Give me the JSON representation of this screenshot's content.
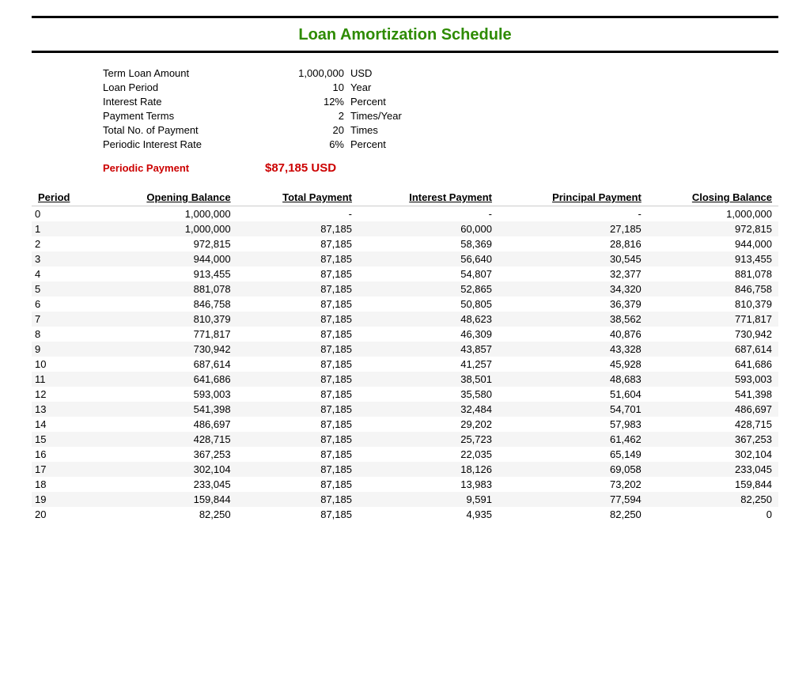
{
  "title": "Loan Amortization Schedule",
  "summary": {
    "rows": [
      {
        "label": "Term Loan Amount",
        "value": "1,000,000",
        "unit": "USD"
      },
      {
        "label": "Loan Period",
        "value": "10",
        "unit": "Year"
      },
      {
        "label": "Interest Rate",
        "value": "12%",
        "unit": "Percent"
      },
      {
        "label": "Payment Terms",
        "value": "2",
        "unit": "Times/Year"
      },
      {
        "label": "Total No. of Payment",
        "value": "20",
        "unit": "Times"
      },
      {
        "label": "Periodic Interest Rate",
        "value": "6%",
        "unit": "Percent"
      }
    ],
    "periodic_payment_label": "Periodic Payment",
    "periodic_payment_value": "$87,185",
    "periodic_payment_unit": "USD"
  },
  "table": {
    "headers": [
      "Period",
      "Opening Balance",
      "Total Payment",
      "Interest Payment",
      "Principal Payment",
      "Closing Balance"
    ],
    "rows": [
      {
        "period": "0",
        "opening": "1,000,000",
        "total": "-",
        "interest": "-",
        "principal": "-",
        "closing": "1,000,000"
      },
      {
        "period": "1",
        "opening": "1,000,000",
        "total": "87,185",
        "interest": "60,000",
        "principal": "27,185",
        "closing": "972,815"
      },
      {
        "period": "2",
        "opening": "972,815",
        "total": "87,185",
        "interest": "58,369",
        "principal": "28,816",
        "closing": "944,000"
      },
      {
        "period": "3",
        "opening": "944,000",
        "total": "87,185",
        "interest": "56,640",
        "principal": "30,545",
        "closing": "913,455"
      },
      {
        "period": "4",
        "opening": "913,455",
        "total": "87,185",
        "interest": "54,807",
        "principal": "32,377",
        "closing": "881,078"
      },
      {
        "period": "5",
        "opening": "881,078",
        "total": "87,185",
        "interest": "52,865",
        "principal": "34,320",
        "closing": "846,758"
      },
      {
        "period": "6",
        "opening": "846,758",
        "total": "87,185",
        "interest": "50,805",
        "principal": "36,379",
        "closing": "810,379"
      },
      {
        "period": "7",
        "opening": "810,379",
        "total": "87,185",
        "interest": "48,623",
        "principal": "38,562",
        "closing": "771,817"
      },
      {
        "period": "8",
        "opening": "771,817",
        "total": "87,185",
        "interest": "46,309",
        "principal": "40,876",
        "closing": "730,942"
      },
      {
        "period": "9",
        "opening": "730,942",
        "total": "87,185",
        "interest": "43,857",
        "principal": "43,328",
        "closing": "687,614"
      },
      {
        "period": "10",
        "opening": "687,614",
        "total": "87,185",
        "interest": "41,257",
        "principal": "45,928",
        "closing": "641,686"
      },
      {
        "period": "11",
        "opening": "641,686",
        "total": "87,185",
        "interest": "38,501",
        "principal": "48,683",
        "closing": "593,003"
      },
      {
        "period": "12",
        "opening": "593,003",
        "total": "87,185",
        "interest": "35,580",
        "principal": "51,604",
        "closing": "541,398"
      },
      {
        "period": "13",
        "opening": "541,398",
        "total": "87,185",
        "interest": "32,484",
        "principal": "54,701",
        "closing": "486,697"
      },
      {
        "period": "14",
        "opening": "486,697",
        "total": "87,185",
        "interest": "29,202",
        "principal": "57,983",
        "closing": "428,715"
      },
      {
        "period": "15",
        "opening": "428,715",
        "total": "87,185",
        "interest": "25,723",
        "principal": "61,462",
        "closing": "367,253"
      },
      {
        "period": "16",
        "opening": "367,253",
        "total": "87,185",
        "interest": "22,035",
        "principal": "65,149",
        "closing": "302,104"
      },
      {
        "period": "17",
        "opening": "302,104",
        "total": "87,185",
        "interest": "18,126",
        "principal": "69,058",
        "closing": "233,045"
      },
      {
        "period": "18",
        "opening": "233,045",
        "total": "87,185",
        "interest": "13,983",
        "principal": "73,202",
        "closing": "159,844"
      },
      {
        "period": "19",
        "opening": "159,844",
        "total": "87,185",
        "interest": "9,591",
        "principal": "77,594",
        "closing": "82,250"
      },
      {
        "period": "20",
        "opening": "82,250",
        "total": "87,185",
        "interest": "4,935",
        "principal": "82,250",
        "closing": "0"
      }
    ]
  }
}
